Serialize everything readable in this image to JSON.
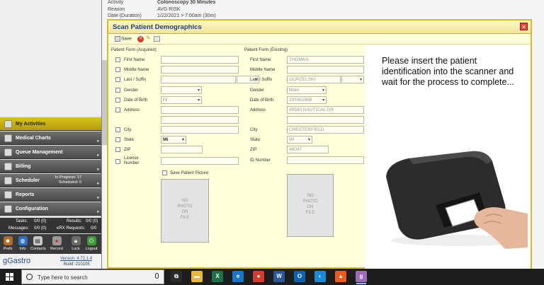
{
  "window_bg": {
    "rows": [
      {
        "label": "Activity",
        "value": "Colonoscopy 30 Minutes"
      },
      {
        "label": "Reason",
        "value": "AVG RISK"
      },
      {
        "label": "Date (Duration)",
        "value": "1/22/2021 > 7:00am (30m)"
      }
    ]
  },
  "sidebar": {
    "items": [
      {
        "label": "My Activities"
      },
      {
        "label": "Medical Charts"
      },
      {
        "label": "Queue Management"
      },
      {
        "label": "Billing"
      },
      {
        "label": "Scheduler",
        "sub1": "In Progress: 17",
        "sub2": "Scheduled: 0"
      },
      {
        "label": "Reports"
      },
      {
        "label": "Configuration"
      }
    ],
    "stats": {
      "tasks_label": "Tasks:",
      "tasks_value": "0/0 (0)",
      "results_label": "Results:",
      "results_value": "0/0 (0)",
      "messages_label": "Messages:",
      "messages_value": "0/0 (0)",
      "erx_label": "eRX Requests:",
      "erx_value": "0/0"
    },
    "toolbar": [
      {
        "label": "Prefs",
        "icon": "person-icon"
      },
      {
        "label": "Info",
        "icon": "globe-icon"
      },
      {
        "label": "Contacts",
        "icon": "contacts-icon"
      },
      {
        "label": "Record",
        "icon": "record-icon"
      },
      {
        "label": "Lock",
        "icon": "lock-icon"
      },
      {
        "label": "Logout",
        "icon": "power-icon"
      }
    ],
    "brand": {
      "logo": "gGastro",
      "version": "Version: 4.72.1.4",
      "build": "Build: 210105"
    }
  },
  "modal": {
    "title": "Scan Patient Demographics",
    "save_label": "Save",
    "acquired_title": "Patient Form (Acquired)",
    "existing_title": "Patient Form (Existing)",
    "acquired_labels": {
      "first_name": "First Name",
      "middle_name": "Middle Name",
      "last_suffix": "Last / Suffix",
      "gender": "Gender",
      "dob": "Date of Birth",
      "address": "Address",
      "city": "City",
      "state": "State",
      "zip": "ZIP",
      "license": "License Number"
    },
    "acquired_values": {
      "dob": "/   /",
      "state": "MI"
    },
    "save_picture_label": "Save Patient Picture",
    "existing_labels": {
      "first_name": "First Name",
      "middle_name": "Middle Name",
      "last_suffix": "Last / Suffix",
      "gender": "Gender",
      "dob": "Date of Birth",
      "address": "Address",
      "city": "City",
      "state": "State",
      "zip": "ZIP",
      "id_number": "ID Number"
    },
    "existing_values": {
      "first_name": "THOMAS",
      "last_name": "GORZELSKI",
      "gender": "Male",
      "dob": "10/08/1968",
      "address": "49590 NAUTICAL DR",
      "city": "CHESTERFIELD",
      "state": "MI",
      "zip": "48047"
    },
    "no_photo_lines": [
      "NO",
      "PHOTO",
      "ON",
      "FILE"
    ],
    "instructions": "Please insert the patient identification into the scanner and wait for the process to complete..."
  },
  "taskbar": {
    "search_placeholder": "Type here to search",
    "apps": [
      {
        "icon": "task-view-icon",
        "color": "#2b2b2b",
        "glyph": "⧉"
      },
      {
        "icon": "file-explorer-icon",
        "color": "#e8b83a",
        "glyph": "▬"
      },
      {
        "icon": "excel-icon",
        "color": "#1e7145",
        "glyph": "X"
      },
      {
        "icon": "edge-legacy-icon",
        "color": "#1e74c9",
        "glyph": "e"
      },
      {
        "icon": "chrome-icon",
        "color": "#d33b2c",
        "glyph": "●"
      },
      {
        "icon": "word-icon",
        "color": "#2b5797",
        "glyph": "W"
      },
      {
        "icon": "outlook-icon",
        "color": "#0a64ad",
        "glyph": "O"
      },
      {
        "icon": "edge-icon",
        "color": "#1a8ad6",
        "glyph": "◐"
      },
      {
        "icon": "brave-icon",
        "color": "#f05a1c",
        "glyph": "▲"
      },
      {
        "icon": "gastro-app-icon",
        "color": "#9b6bb8",
        "glyph": "g"
      }
    ]
  }
}
